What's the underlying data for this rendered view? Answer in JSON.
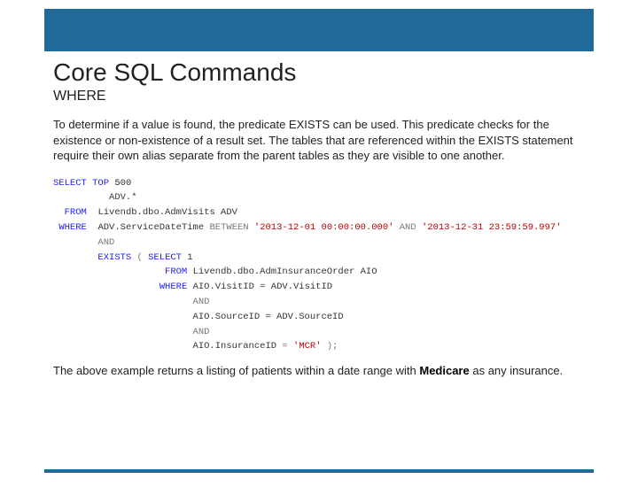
{
  "title": "Core SQL Commands",
  "subtitle": "WHERE",
  "intro": "To determine if a value is found, the predicate EXISTS can be used.  This predicate checks for the existence or non-existence of a result set.  The tables that are referenced within the EXISTS statement require their own alias separate from the parent tables as they are visible to one another.",
  "sql": {
    "select": "SELECT",
    "top": "TOP",
    "topn": "500",
    "cols": "ADV.*",
    "from": "FROM",
    "table1": "Livendb.dbo.AdmVisits ADV",
    "where": "WHERE",
    "cond1_lhs": "ADV.ServiceDateTime",
    "between": "BETWEEN",
    "d1": "'2013-12-01 00:00:00.000'",
    "mid_and": "AND",
    "d2": "'2013-12-31 23:59:59.997'",
    "and": "AND",
    "exists": "EXISTS",
    "lp": "(",
    "inner_select": "SELECT",
    "inner_cols": "1",
    "inner_from": "FROM",
    "inner_table": "Livendb.dbo.AdmInsuranceOrder AIO",
    "inner_where": "WHERE",
    "inner_c1": "AIO.VisitID = ADV.VisitID",
    "inner_and1": "AND",
    "inner_c2": "AIO.SourceID = ADV.SourceID",
    "inner_and2": "AND",
    "inner_c3_lhs": "AIO.InsuranceID",
    "inner_c3_eq": "=",
    "inner_c3_rhs": "'MCR'",
    "rp": ");"
  },
  "outro_pre": "The above example returns a listing of patients within a date range with ",
  "outro_bold": "Medicare",
  "outro_post": " as any insurance."
}
